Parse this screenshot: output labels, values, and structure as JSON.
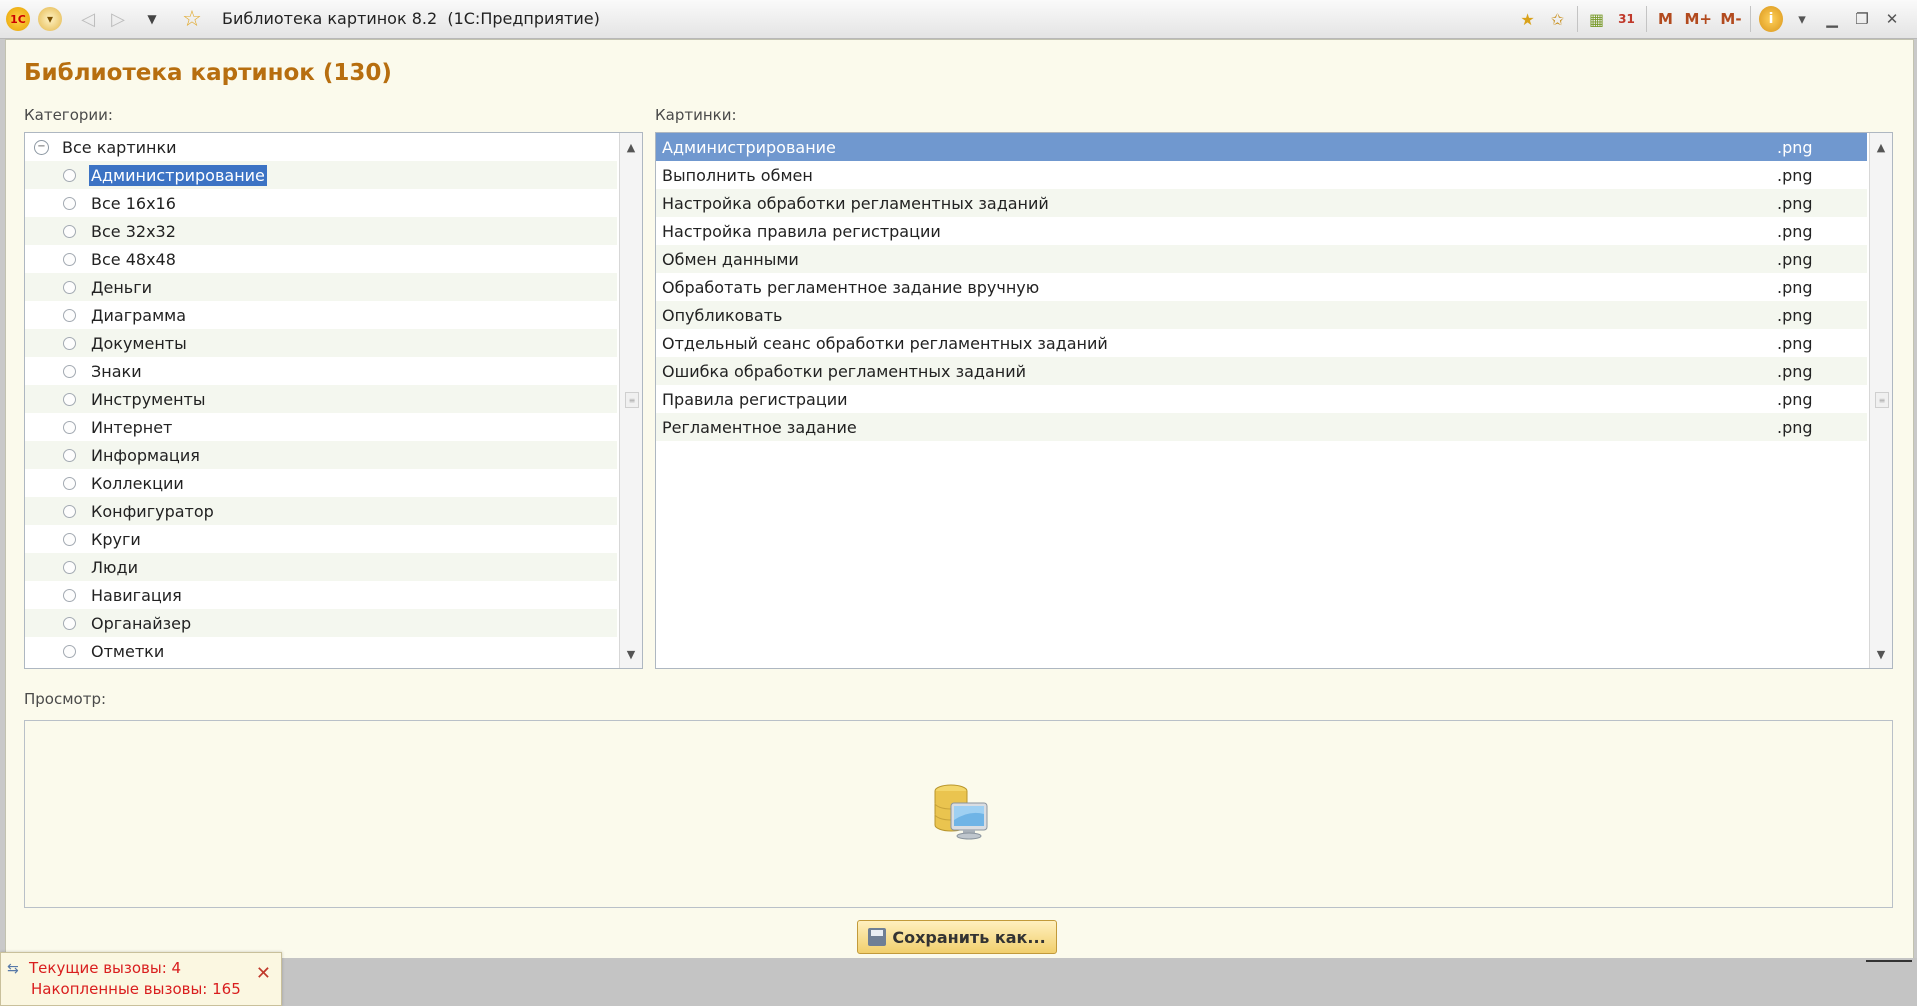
{
  "window": {
    "title": "Библиотека картинок 8.2  (1С:Предприятие)"
  },
  "toolbar": {
    "m": "M",
    "m_plus": "M+",
    "m_minus": "M-",
    "info": "i",
    "calendar": "31"
  },
  "form": {
    "title": "Библиотека картинок (130)",
    "categories_label": "Категории:",
    "pictures_label": "Картинки:",
    "preview_label": "Просмотр:",
    "save_button": "Сохранить как..."
  },
  "categories": {
    "root": "Все картинки",
    "items": [
      "Администрирование",
      "Все 16x16",
      "Все 32x32",
      "Все 48x48",
      "Деньги",
      "Диаграмма",
      "Документы",
      "Знаки",
      "Инструменты",
      "Интернет",
      "Информация",
      "Коллекции",
      "Конфигуратор",
      "Круги",
      "Люди",
      "Навигация",
      "Органайзер",
      "Отметки"
    ],
    "selected": "Администрирование"
  },
  "pictures": [
    {
      "name": "Администрирование",
      "ext": ".png"
    },
    {
      "name": "Выполнить обмен",
      "ext": ".png"
    },
    {
      "name": "Настройка обработки регламентных заданий",
      "ext": ".png"
    },
    {
      "name": "Настройка правила регистрации",
      "ext": ".png"
    },
    {
      "name": "Обмен данными",
      "ext": ".png"
    },
    {
      "name": "Обработать регламентное задание вручную",
      "ext": ".png"
    },
    {
      "name": "Опубликовать",
      "ext": ".png"
    },
    {
      "name": "Отдельный сеанс обработки регламентных заданий",
      "ext": ".png"
    },
    {
      "name": "Ошибка обработки регламентных заданий",
      "ext": ".png"
    },
    {
      "name": "Правила регистрации",
      "ext": ".png"
    },
    {
      "name": "Регламентное задание",
      "ext": ".png"
    }
  ],
  "notification": {
    "current_calls": "Текущие вызовы: 4",
    "accumulated_calls": "Накопленные вызовы: 165"
  },
  "colors": {
    "title_accent": "#b76e0f",
    "selection": "#7098cf",
    "notify_text": "#d91e1e"
  }
}
